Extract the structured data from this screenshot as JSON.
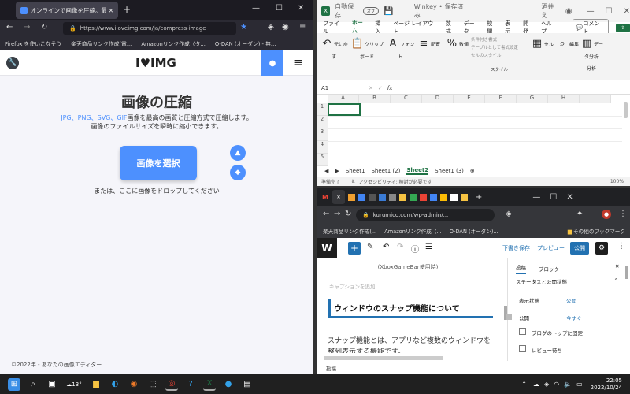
{
  "firefox": {
    "tab_title": "オンラインで画像を圧縮。最高の品",
    "url": "https://www.iloveimg.com/ja/compress-image",
    "bookmarks": [
      "Firefox を使いこなそう",
      "楽天商品リンク作成(電...",
      "Amazonリンク作成（タ...",
      "O-DAN (オーダン) - 無..."
    ],
    "site": {
      "logo": "I♥IMG",
      "title": "画像の圧縮",
      "desc_formats": "JPG、PNG、SVG、GIF",
      "desc_line1": "画像を最高の画質と圧縮方式で圧縮します。",
      "desc_line2": "画像のファイルサイズを瞬時に縮小できます。",
      "select_button": "画像を選択",
      "drop_text": "または、ここに画像をドロップしてください",
      "footer": "©2022年 - あなたの画像エディター"
    }
  },
  "excel": {
    "autosave": "自動保存",
    "toggle": "オフ",
    "doc_title": "Winkey • 保存済み",
    "user": "酒井 え",
    "menu": [
      "ファイル",
      "ホーム",
      "挿入",
      "ページ レイアウト",
      "数式",
      "データ",
      "校閲",
      "表示",
      "開発",
      "ヘルプ"
    ],
    "comment_button": "コメント",
    "ribbon": {
      "undo": "元に戻す",
      "clipboard": "クリップボード",
      "font": "フォント",
      "align": "配置",
      "number": "数値",
      "cond_format": "条件付き書式",
      "table_format": "テーブルとして書式設定",
      "cell_style": "セルのスタイル",
      "style_group": "スタイル",
      "cell": "セル",
      "edit": "編集",
      "data_analysis": "データ分析",
      "analysis_group": "分析"
    },
    "cell_ref": "A1",
    "fx": "fx",
    "columns": [
      "A",
      "B",
      "C",
      "D",
      "E",
      "F",
      "G",
      "H",
      "I"
    ],
    "rows": [
      "1",
      "2",
      "3",
      "4",
      "5"
    ],
    "sheets": [
      "Sheet1",
      "Sheet1 (2)",
      "Sheet2",
      "Sheet1 (3)"
    ],
    "active_sheet": "Sheet2",
    "status_ready": "準備完了",
    "status_access": "アクセシビリティ: 検討が必要です",
    "zoom": "100%"
  },
  "chrome": {
    "url": "kurumico.com/wp-admin/...",
    "bookmarks": [
      "楽天商品リンク作成(...",
      "Amazonリンク作成（...",
      "O-DAN (オーダン)..."
    ],
    "other_bookmarks": "その他のブックマーク",
    "wp": {
      "save_draft": "下書き保存",
      "preview": "プレビュー",
      "publish": "公開",
      "caption_top": "(XboxGameBar使用時)",
      "caption_placeholder": "キャプションを追加",
      "heading": "ウィンドウのスナップ機能について",
      "paragraph": "スナップ機能とは、アプリなど複数のウィンドウを整列表示する機能です。",
      "footer_label": "投稿",
      "tab_post": "投稿",
      "tab_block": "ブロック",
      "panel_title": "ステータスと公開状態",
      "visibility_label": "表示状態",
      "visibility_value": "公開",
      "publish_label": "公開",
      "publish_value": "今すぐ",
      "sticky": "ブログのトップに固定",
      "review": "レビュー待ち"
    }
  },
  "taskbar": {
    "weather": "13°",
    "time": "22:05",
    "date": "2022/10/24"
  },
  "colors": {
    "ilove_red": "#e5322d",
    "ilove_blue": "#4d90fe",
    "excel_green": "#1f7244",
    "wp_blue": "#2271b1"
  }
}
